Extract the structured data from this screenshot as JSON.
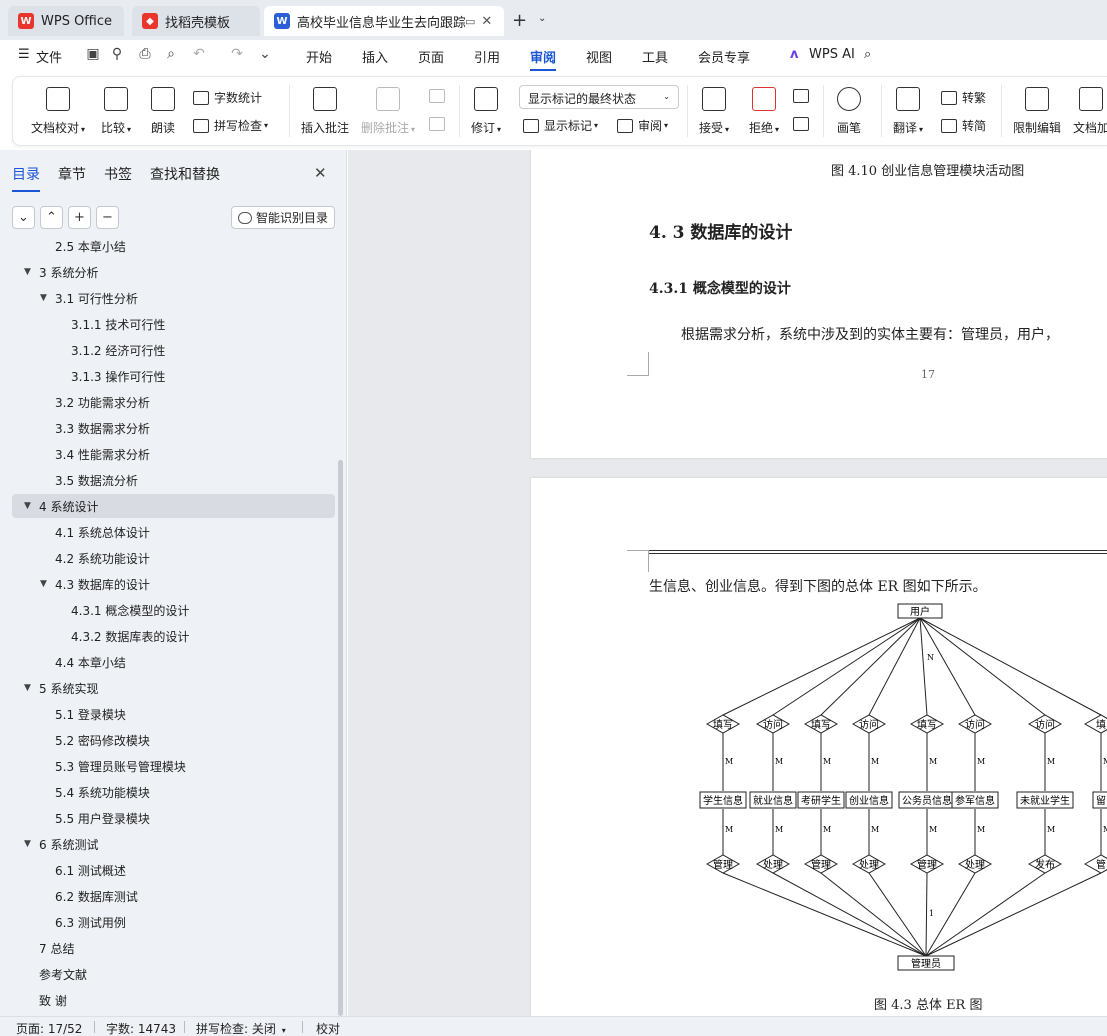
{
  "tabs": [
    {
      "label": "WPS Office",
      "icon": "wps-logo-icon"
    },
    {
      "label": "找稻壳模板",
      "icon": "docer-icon"
    },
    {
      "label": "高校毕业信息毕业生去向跟踪系",
      "icon": "word-doc-icon"
    }
  ],
  "menu": {
    "file": "文件",
    "tabs": [
      "开始",
      "插入",
      "页面",
      "引用",
      "审阅",
      "视图",
      "工具",
      "会员专享"
    ],
    "active_tab": "审阅",
    "wps_ai": "WPS AI"
  },
  "ribbon": {
    "doc_proofread": "文档校对",
    "compare": "比较",
    "read_aloud": "朗读",
    "word_count": "字数统计",
    "spell_check": "拼写检查",
    "insert_comment": "插入批注",
    "delete_comment": "删除批注",
    "track_changes": "修订",
    "show_markup_state": "显示标记的最终状态",
    "show_markup": "显示标记",
    "review": "审阅",
    "accept": "接受",
    "reject": "拒绝",
    "ink": "画笔",
    "translate": "翻译",
    "to_traditional": "转繁",
    "to_simplified": "转简",
    "restrict_edit": "限制编辑",
    "doc_encrypt": "文档加"
  },
  "nav": {
    "tabs": [
      "目录",
      "章节",
      "书签",
      "查找和替换"
    ],
    "smart_toc": "智能识别目录",
    "toc": [
      {
        "label": "2.5 本章小结",
        "level": 2
      },
      {
        "label": "3  系统分析",
        "level": 1,
        "expanded": true
      },
      {
        "label": "3.1 可行性分析",
        "level": 2,
        "expanded": true
      },
      {
        "label": "3.1.1  技术可行性",
        "level": 3
      },
      {
        "label": "3.1.2  经济可行性",
        "level": 3
      },
      {
        "label": "3.1.3  操作可行性",
        "level": 3
      },
      {
        "label": "3.2  功能需求分析",
        "level": 2
      },
      {
        "label": "3.3  数据需求分析",
        "level": 2
      },
      {
        "label": "3.4  性能需求分析",
        "level": 2
      },
      {
        "label": "3.5 数据流分析",
        "level": 2
      },
      {
        "label": "4    系统设计",
        "level": 1,
        "expanded": true,
        "selected": true
      },
      {
        "label": "4.1 系统总体设计",
        "level": 2
      },
      {
        "label": "4.2 系统功能设计",
        "level": 2
      },
      {
        "label": "4.3  数据库的设计",
        "level": 2,
        "expanded": true
      },
      {
        "label": "4.3.1  概念模型的设计",
        "level": 3
      },
      {
        "label": "4.3.2  数据库表的设计",
        "level": 3
      },
      {
        "label": "4.4 本章小结",
        "level": 2
      },
      {
        "label": "5    系统实现",
        "level": 1,
        "expanded": true
      },
      {
        "label": "5.1 登录模块",
        "level": 2
      },
      {
        "label": "5.2 密码修改模块",
        "level": 2
      },
      {
        "label": "5.3 管理员账号管理模块",
        "level": 2
      },
      {
        "label": "5.4 系统功能模块",
        "level": 2
      },
      {
        "label": "5.5 用户登录模块",
        "level": 2
      },
      {
        "label": "6    系统测试",
        "level": 1,
        "expanded": true
      },
      {
        "label": "6.1 测试概述",
        "level": 2
      },
      {
        "label": "6.2 数据库测试",
        "level": 2
      },
      {
        "label": "6.3 测试用例",
        "level": 2
      },
      {
        "label": "7    总结",
        "level": 1
      },
      {
        "label": "参考文献",
        "level": 1
      },
      {
        "label": "致  谢",
        "level": 1
      }
    ]
  },
  "document": {
    "fig_410_caption": "图 4.10 创业信息管理模块活动图",
    "h_43": "4. 3  数据库的设计",
    "h_431": "4.3.1  概念模型的设计",
    "para1": "根据需求分析，系统中涉及到的实体主要有：管理员，用户，",
    "page_number": "17",
    "para2": "生信息、创业信息。得到下图的总体 ER 图如下所示。",
    "er": {
      "top_entity": "用户",
      "bottom_entity": "管理员",
      "relations_top": [
        "填写",
        "访问",
        "填写",
        "访问",
        "填写",
        "访问",
        "访问",
        "填"
      ],
      "entities_mid": [
        "学生信息",
        "就业信息",
        "考研学生",
        "创业信息",
        "公务员信息",
        "参军信息",
        "未就业学生",
        "留"
      ],
      "relations_bottom": [
        "管理",
        "处理",
        "管理",
        "处理",
        "管理",
        "处理",
        "发布",
        "管"
      ],
      "card_m": "M",
      "card_n": "N",
      "card_1": "1"
    },
    "fig_43_caption": "图 4.3 总体 ER 图"
  },
  "status": {
    "page": "页面: 17/52",
    "words": "字数: 14743",
    "spell": "拼写检查: 关闭",
    "proof": "校对"
  }
}
